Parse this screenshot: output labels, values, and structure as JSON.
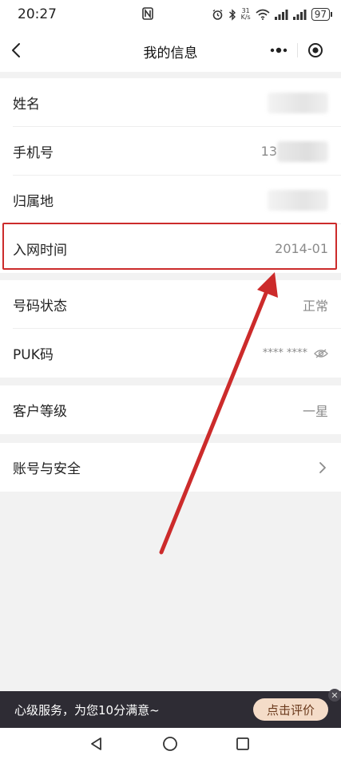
{
  "status_bar": {
    "time": "20:27",
    "speed_top": "31",
    "speed_bottom": "K/s",
    "battery": "97",
    "icons": [
      "nfc-icon",
      "alarm-icon",
      "bluetooth-icon",
      "wifi-icon",
      "signal-icon",
      "signal-icon",
      "battery-icon"
    ]
  },
  "nav": {
    "title": "我的信息",
    "back_icon": "chevron-left-icon",
    "more_icon": "more-dots-icon",
    "close_icon": "target-close-icon"
  },
  "group1": [
    {
      "label": "姓名",
      "value": ""
    },
    {
      "label": "手机号",
      "value": "13"
    },
    {
      "label": "归属地",
      "value": ""
    },
    {
      "label": "入网时间",
      "value": "2014-01"
    }
  ],
  "group2": [
    {
      "label": "号码状态",
      "value": "正常"
    },
    {
      "label": "PUK码",
      "value": "**** ****"
    }
  ],
  "group3": [
    {
      "label": "客户等级",
      "value": "一星"
    }
  ],
  "group4": [
    {
      "label": "账号与安全",
      "value": ""
    }
  ],
  "annotation": {
    "color": "#cc2b2b"
  },
  "promo": {
    "text": "心级服务，为您10分满意~",
    "button": "点击评价"
  },
  "colors": {
    "accent": "#cc2b2b",
    "promo_bg": "#2e2c34",
    "promo_button": "#f4dcc8"
  }
}
